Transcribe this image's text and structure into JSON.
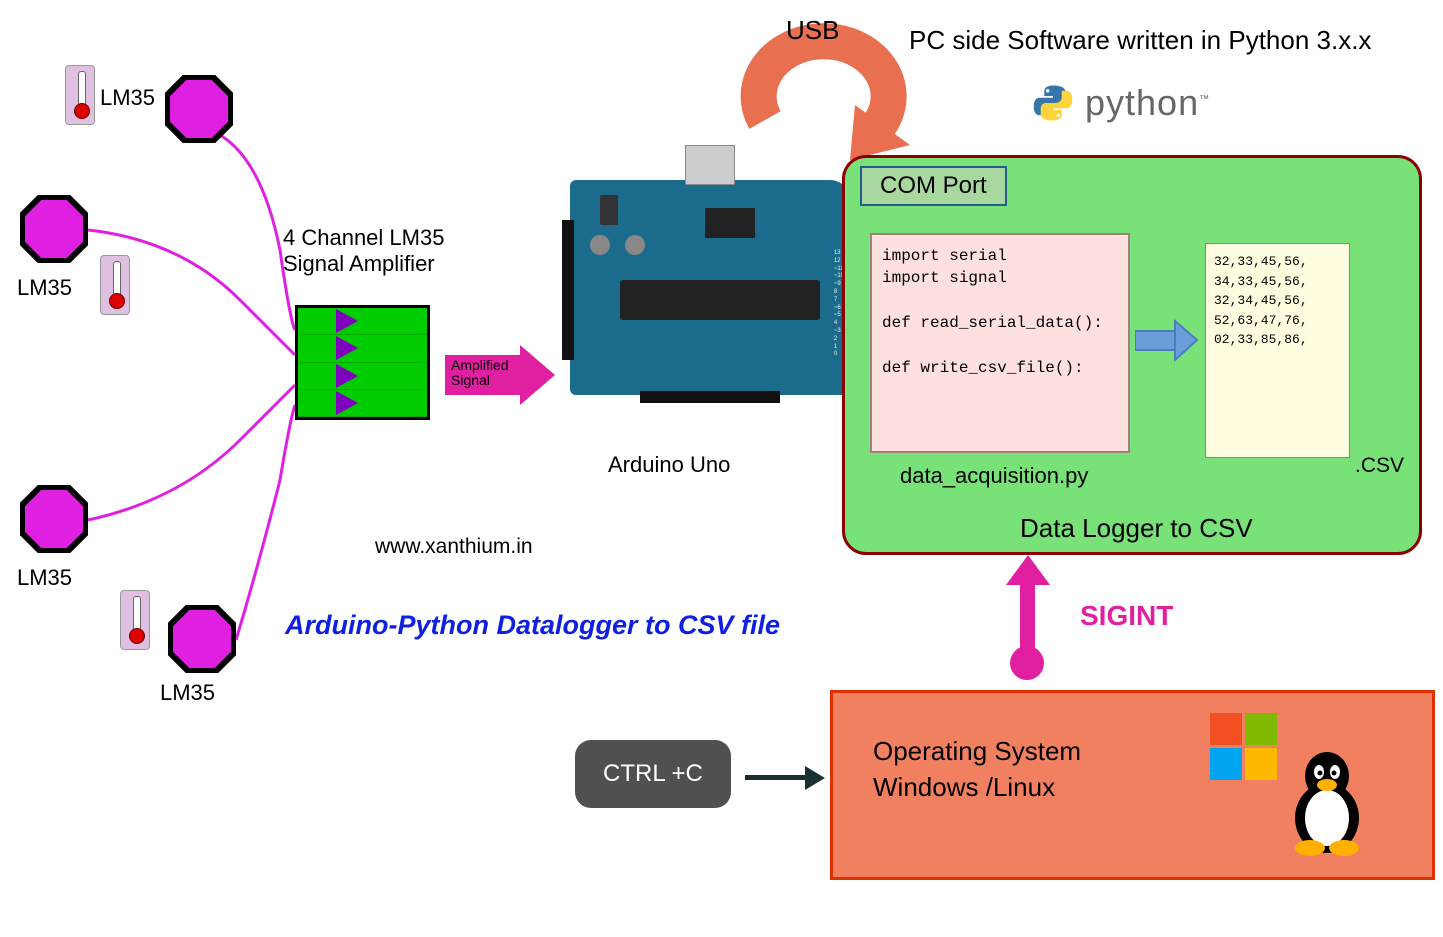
{
  "sensors": {
    "label": "LM35"
  },
  "amplifier": {
    "title_line1": "4 Channel LM35",
    "title_line2": "Signal Amplifier",
    "arrow_label_line1": "Amplified",
    "arrow_label_line2": "Signal"
  },
  "arduino": {
    "label": "Arduino Uno",
    "pin_text": "13\n12\n~11\n~10\n~9\n8\n7\n~6\n~5\n4\n~3\n2\n1\n0"
  },
  "usb": {
    "label": "USB"
  },
  "pc_side": {
    "heading": "PC side Software written in Python 3.x.x",
    "python_label": "python",
    "tm": "™"
  },
  "green_panel": {
    "com_port": "COM Port",
    "code": "import serial\nimport signal\n\ndef read_serial_data():\n\ndef write_csv_file():",
    "code_filename": "data_acquisition.py",
    "csv_data": "32,33,45,56,\n34,33,45,56,\n32,34,45,56,\n52,63,47,76,\n02,33,85,86,",
    "csv_label": ".CSV",
    "bottom_label": "Data Logger to CSV"
  },
  "sigint": {
    "label": "SIGINT"
  },
  "os_box": {
    "line1": "Operating System",
    "line2": "Windows /Linux"
  },
  "ctrl_c": {
    "label": "CTRL +C"
  },
  "title": "Arduino-Python Datalogger to CSV file",
  "website": "www.xanthium.in"
}
